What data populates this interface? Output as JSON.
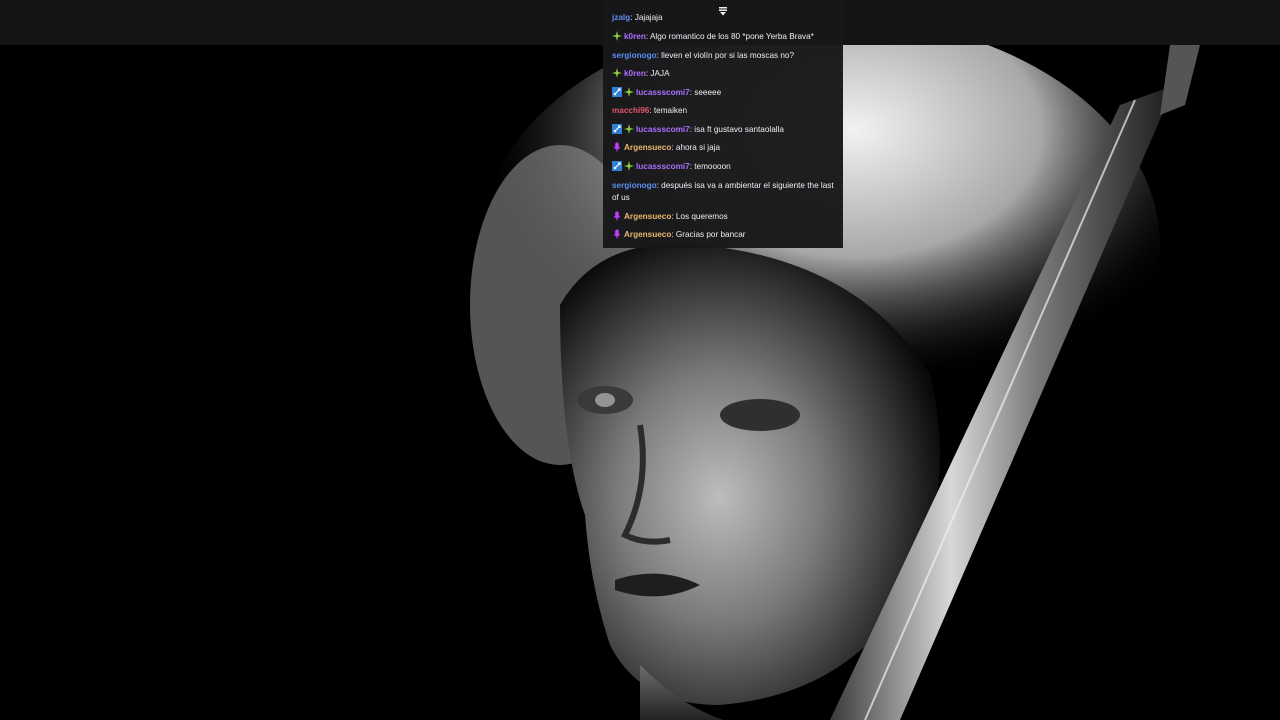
{
  "colors": {
    "chat_bg": "#18181b",
    "top_bar": "#141414",
    "user_blue": "#5b8ef0",
    "user_purple": "#a970ff",
    "user_red": "#e0566b",
    "user_gold": "#e8b86b",
    "badge_green": "#8bd33a",
    "badge_blue": "#2f7fd4",
    "badge_magenta": "#c23cff"
  },
  "chat": {
    "pause_icon": "chat-paused-icon",
    "messages": [
      {
        "badges": [],
        "user": "jzalg",
        "color": "#5b8ef0",
        "text": "Jajajaja"
      },
      {
        "badges": [
          "sparkle"
        ],
        "user": "k0ren",
        "color": "#a970ff",
        "text": "Algo romantico de los 80 *pone Yerba Brava*"
      },
      {
        "badges": [],
        "user": "sergionogo",
        "color": "#5b8ef0",
        "text": "lleven el violín por si las moscas no?"
      },
      {
        "badges": [
          "sparkle"
        ],
        "user": "k0ren",
        "color": "#a970ff",
        "text": "JAJA"
      },
      {
        "badges": [
          "sword",
          "sparkle"
        ],
        "user": "lucassscomi7",
        "color": "#a970ff",
        "text": "seeeee"
      },
      {
        "badges": [],
        "user": "macchi96",
        "color": "#e0566b",
        "text": "temaiken"
      },
      {
        "badges": [
          "sword",
          "sparkle"
        ],
        "user": "lucassscomi7",
        "color": "#a970ff",
        "text": "isa ft gustavo santaolalla"
      },
      {
        "badges": [
          "mic"
        ],
        "user": "Argensueco",
        "color": "#e8b86b",
        "text": "ahora si jaja"
      },
      {
        "badges": [
          "sword",
          "sparkle"
        ],
        "user": "lucassscomi7",
        "color": "#a970ff",
        "text": "temoooon"
      },
      {
        "badges": [],
        "user": "sergionogo",
        "color": "#5b8ef0",
        "text": "después isa va a ambientar el siguiente the last of us"
      },
      {
        "badges": [
          "mic"
        ],
        "user": "Argensueco",
        "color": "#e8b86b",
        "text": "Los queremos"
      },
      {
        "badges": [
          "mic"
        ],
        "user": "Argensueco",
        "color": "#e8b86b",
        "text": "Gracias por bancar"
      }
    ]
  }
}
